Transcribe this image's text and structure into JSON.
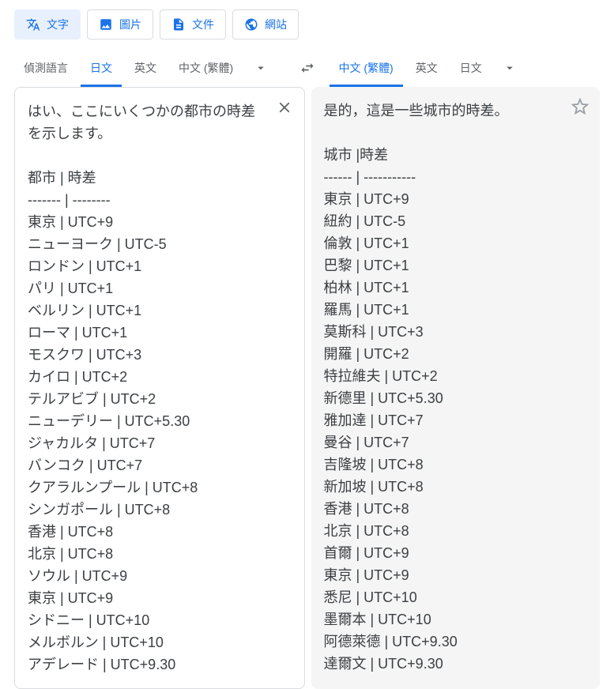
{
  "inputTabs": {
    "text": "文字",
    "image": "圖片",
    "document": "文件",
    "website": "網站"
  },
  "sourceLangs": {
    "detect": "偵測語言",
    "japanese": "日文",
    "english": "英文",
    "chineseTrad": "中文 (繁體)"
  },
  "targetLangs": {
    "chineseTrad": "中文 (繁體)",
    "english": "英文",
    "japanese": "日文"
  },
  "sourceText": "はい、ここにいくつかの都市の時差を示します。\n\n都市 | 時差\n------- | --------\n東京 | UTC+9\nニューヨーク | UTC-5\nロンドン | UTC+1\nパリ | UTC+1\nベルリン | UTC+1\nローマ | UTC+1\nモスクワ | UTC+3\nカイロ | UTC+2\nテルアビブ | UTC+2\nニューデリー | UTC+5.30\nジャカルタ | UTC+7\nバンコク | UTC+7\nクアラルンプール | UTC+8\nシンガポール | UTC+8\n香港 | UTC+8\n北京 | UTC+8\nソウル | UTC+9\n東京 | UTC+9\nシドニー | UTC+10\nメルボルン | UTC+10\nアデレード | UTC+9.30",
  "targetText": "是的，這是一些城市的時差。\n\n城市 |時差\n------ | -----------\n東京 | UTC+9\n紐約 | UTC-5\n倫敦 | UTC+1\n巴黎 | UTC+1\n柏林 | UTC+1\n羅馬 | UTC+1\n莫斯科 | UTC+3\n開羅 | UTC+2\n特拉維夫 | UTC+2\n新德里 | UTC+5.30\n雅加達 | UTC+7\n曼谷 | UTC+7\n吉隆坡 | UTC+8\n新加坡 | UTC+8\n香港 | UTC+8\n北京 | UTC+8\n首爾 | UTC+9\n東京 | UTC+9\n悉尼 | UTC+10\n墨爾本 | UTC+10\n阿德萊德 | UTC+9.30\n達爾文 | UTC+9.30"
}
